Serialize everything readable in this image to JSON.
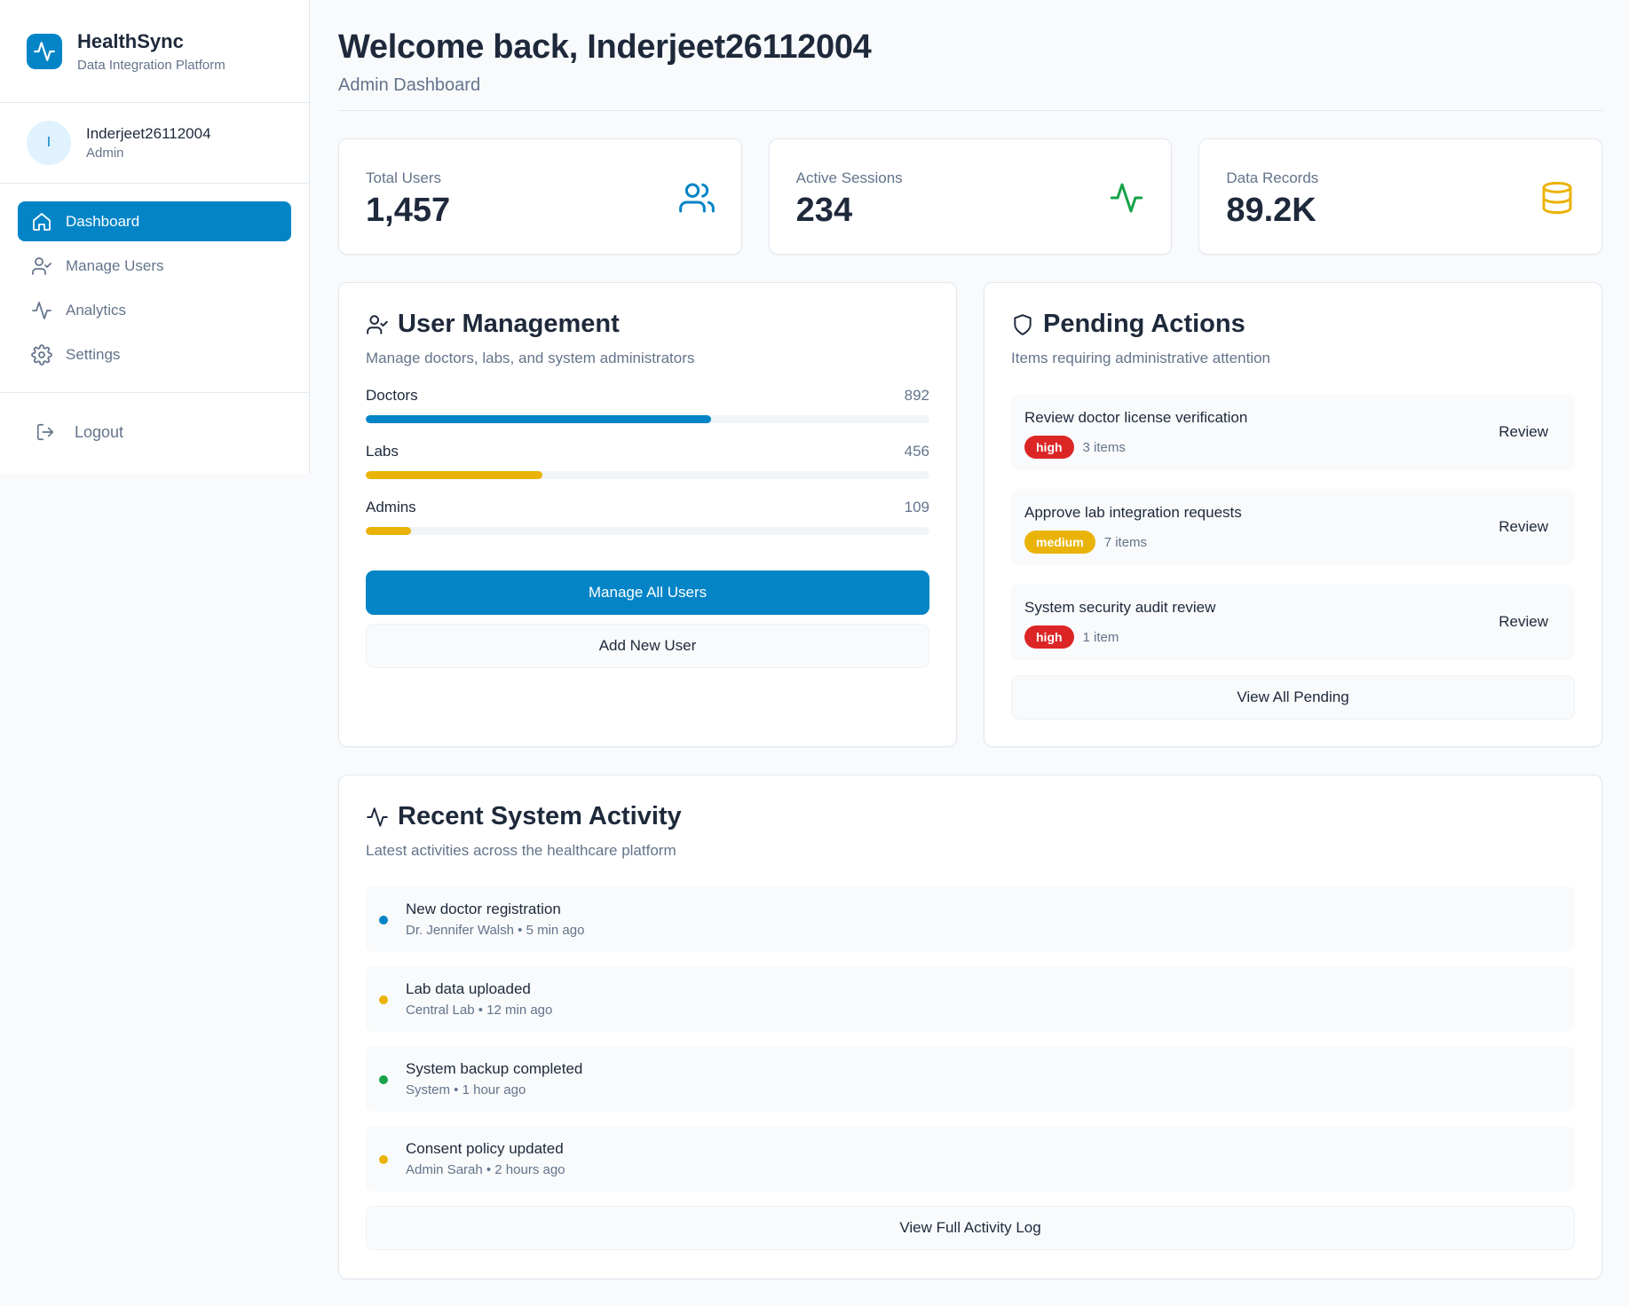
{
  "brand": {
    "name": "HealthSync",
    "subtitle": "Data Integration Platform",
    "icon": "activity-icon"
  },
  "profile": {
    "initial": "I",
    "name": "Inderjeet26112004",
    "role": "Admin"
  },
  "nav": {
    "items": [
      {
        "label": "Dashboard",
        "icon": "home-icon",
        "active": true
      },
      {
        "label": "Manage Users",
        "icon": "user-check-icon",
        "active": false
      },
      {
        "label": "Analytics",
        "icon": "activity-icon",
        "active": false
      },
      {
        "label": "Settings",
        "icon": "gear-icon",
        "active": false
      }
    ],
    "logout": "Logout"
  },
  "header": {
    "title": "Welcome back, Inderjeet26112004",
    "subtitle": "Admin Dashboard"
  },
  "stats": [
    {
      "label": "Total Users",
      "value": "1,457",
      "icon": "users-icon",
      "color": "#0284c7"
    },
    {
      "label": "Active Sessions",
      "value": "234",
      "icon": "activity-icon",
      "color": "#16a34a"
    },
    {
      "label": "Data Records",
      "value": "89.2K",
      "icon": "database-icon",
      "color": "#eab308"
    }
  ],
  "user_management": {
    "title": "User Management",
    "subtitle": "Manage doctors, labs, and system administrators",
    "bars": [
      {
        "label": "Doctors",
        "value": "892",
        "fraction": 0.612,
        "color": "#0284c7"
      },
      {
        "label": "Labs",
        "value": "456",
        "fraction": 0.313,
        "color": "#eab308"
      },
      {
        "label": "Admins",
        "value": "109",
        "fraction": 0.081,
        "color": "#eab308"
      }
    ],
    "primary_button": "Manage All Users",
    "secondary_button": "Add New User"
  },
  "pending": {
    "title": "Pending Actions",
    "subtitle": "Items requiring administrative attention",
    "items": [
      {
        "title": "Review doctor license verification",
        "priority": "high",
        "count": "3 items",
        "action": "Review"
      },
      {
        "title": "Approve lab integration requests",
        "priority": "medium",
        "count": "7 items",
        "action": "Review"
      },
      {
        "title": "System security audit review",
        "priority": "high",
        "count": "1 item",
        "action": "Review"
      }
    ],
    "view_all": "View All Pending"
  },
  "activity": {
    "title": "Recent System Activity",
    "subtitle": "Latest activities across the healthcare platform",
    "items": [
      {
        "title": "New doctor registration",
        "meta": "Dr. Jennifer Walsh • 5 min ago",
        "color": "#0284c7"
      },
      {
        "title": "Lab data uploaded",
        "meta": "Central Lab • 12 min ago",
        "color": "#eab308"
      },
      {
        "title": "System backup completed",
        "meta": "System • 1 hour ago",
        "color": "#16a34a"
      },
      {
        "title": "Consent policy updated",
        "meta": "Admin Sarah • 2 hours ago",
        "color": "#eab308"
      }
    ],
    "view_all": "View Full Activity Log"
  }
}
